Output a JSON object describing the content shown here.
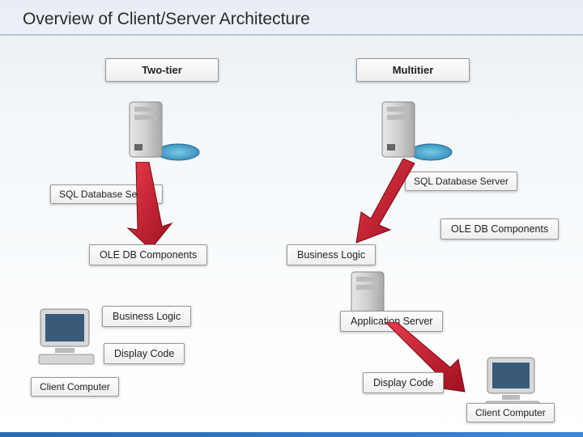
{
  "title": "Overview of Client/Server Architecture",
  "left": {
    "tier_label": "Two-tier",
    "db_server": "SQL Database Server",
    "ole_db": "OLE DB Components",
    "biz_logic": "Business Logic",
    "display_code": "Display Code",
    "client": "Client Computer"
  },
  "right": {
    "tier_label": "Multitier",
    "db_server": "SQL Database Server",
    "ole_db": "OLE DB Components",
    "biz_logic": "Business Logic",
    "app_server": "Application Server",
    "display_code": "Display Code",
    "client": "Client Computer"
  },
  "icons": {
    "server": "server-icon",
    "monitor": "monitor-icon"
  },
  "colors": {
    "arrow": "#d11a2d",
    "arrow_dark": "#8a0f1c"
  }
}
